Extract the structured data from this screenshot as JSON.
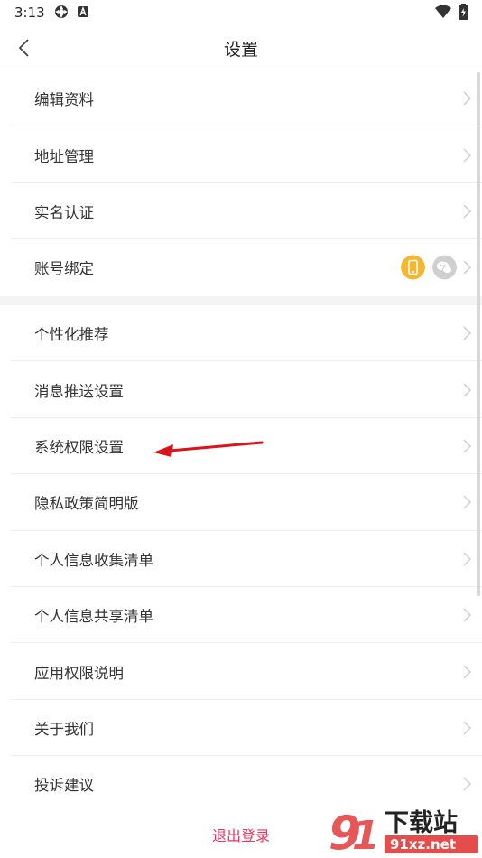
{
  "status_bar": {
    "time": "3:13"
  },
  "nav": {
    "title": "设置"
  },
  "group1": [
    {
      "label": "编辑资料"
    },
    {
      "label": "地址管理"
    },
    {
      "label": "实名认证"
    },
    {
      "label": "账号绑定"
    }
  ],
  "group2": [
    {
      "label": "个性化推荐"
    },
    {
      "label": "消息推送设置"
    },
    {
      "label": "系统权限设置"
    },
    {
      "label": "隐私政策简明版"
    },
    {
      "label": "个人信息收集清单"
    },
    {
      "label": "个人信息共享清单"
    },
    {
      "label": "应用权限说明"
    },
    {
      "label": "关于我们"
    },
    {
      "label": "投诉建议"
    }
  ],
  "logout": {
    "label": "退出登录"
  },
  "watermark": {
    "top": "下载站",
    "bottom": "91xz.net"
  },
  "colors": {
    "accent": "#e8365e",
    "phone_badge": "#f5b731",
    "wechat_badge": "#cfcfcf",
    "annotation_arrow": "#d9141b"
  }
}
